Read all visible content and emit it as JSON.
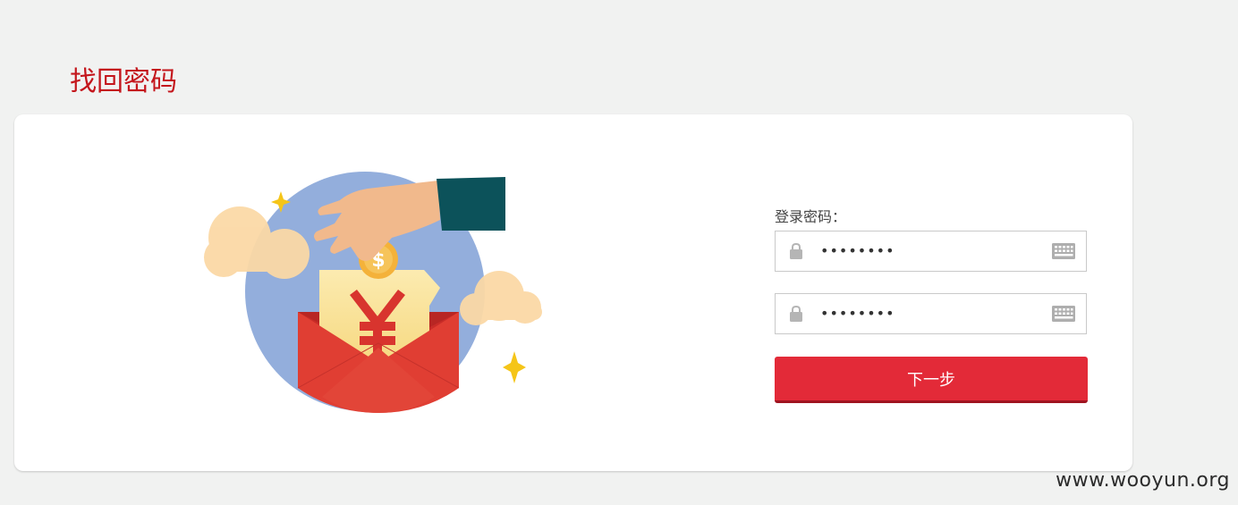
{
  "page": {
    "title": "找回密码"
  },
  "form": {
    "label": "登录密码：",
    "password_value": "••••••••",
    "confirm_value": "••••••••",
    "submit_label": "下一步"
  },
  "illustration": {
    "coin_symbol": "$",
    "card_symbol": "¥"
  },
  "watermark": "www.wooyun.org",
  "colors": {
    "brand_red": "#c4161c",
    "button_red": "#e32a38",
    "background": "#f1f2f1"
  },
  "icons": [
    "lock-icon",
    "keyboard-icon"
  ]
}
